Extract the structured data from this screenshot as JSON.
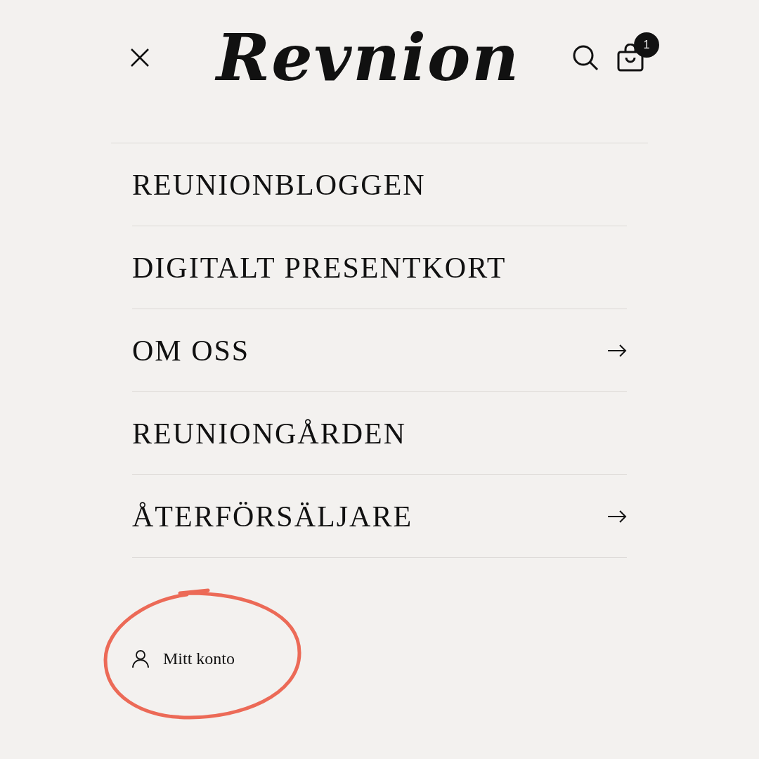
{
  "header": {
    "logo": "Revnion",
    "cart_count": "1"
  },
  "menu": [
    {
      "label": "REUNIONBLOGGEN",
      "has_submenu": false
    },
    {
      "label": "DIGITALT PRESENTKORT",
      "has_submenu": false
    },
    {
      "label": "OM OSS",
      "has_submenu": true
    },
    {
      "label": "REUNIONGÅRDEN",
      "has_submenu": false
    },
    {
      "label": "ÅTERFÖRSÄLJARE",
      "has_submenu": true
    }
  ],
  "account": {
    "label": "Mitt konto",
    "highlighted": true
  }
}
